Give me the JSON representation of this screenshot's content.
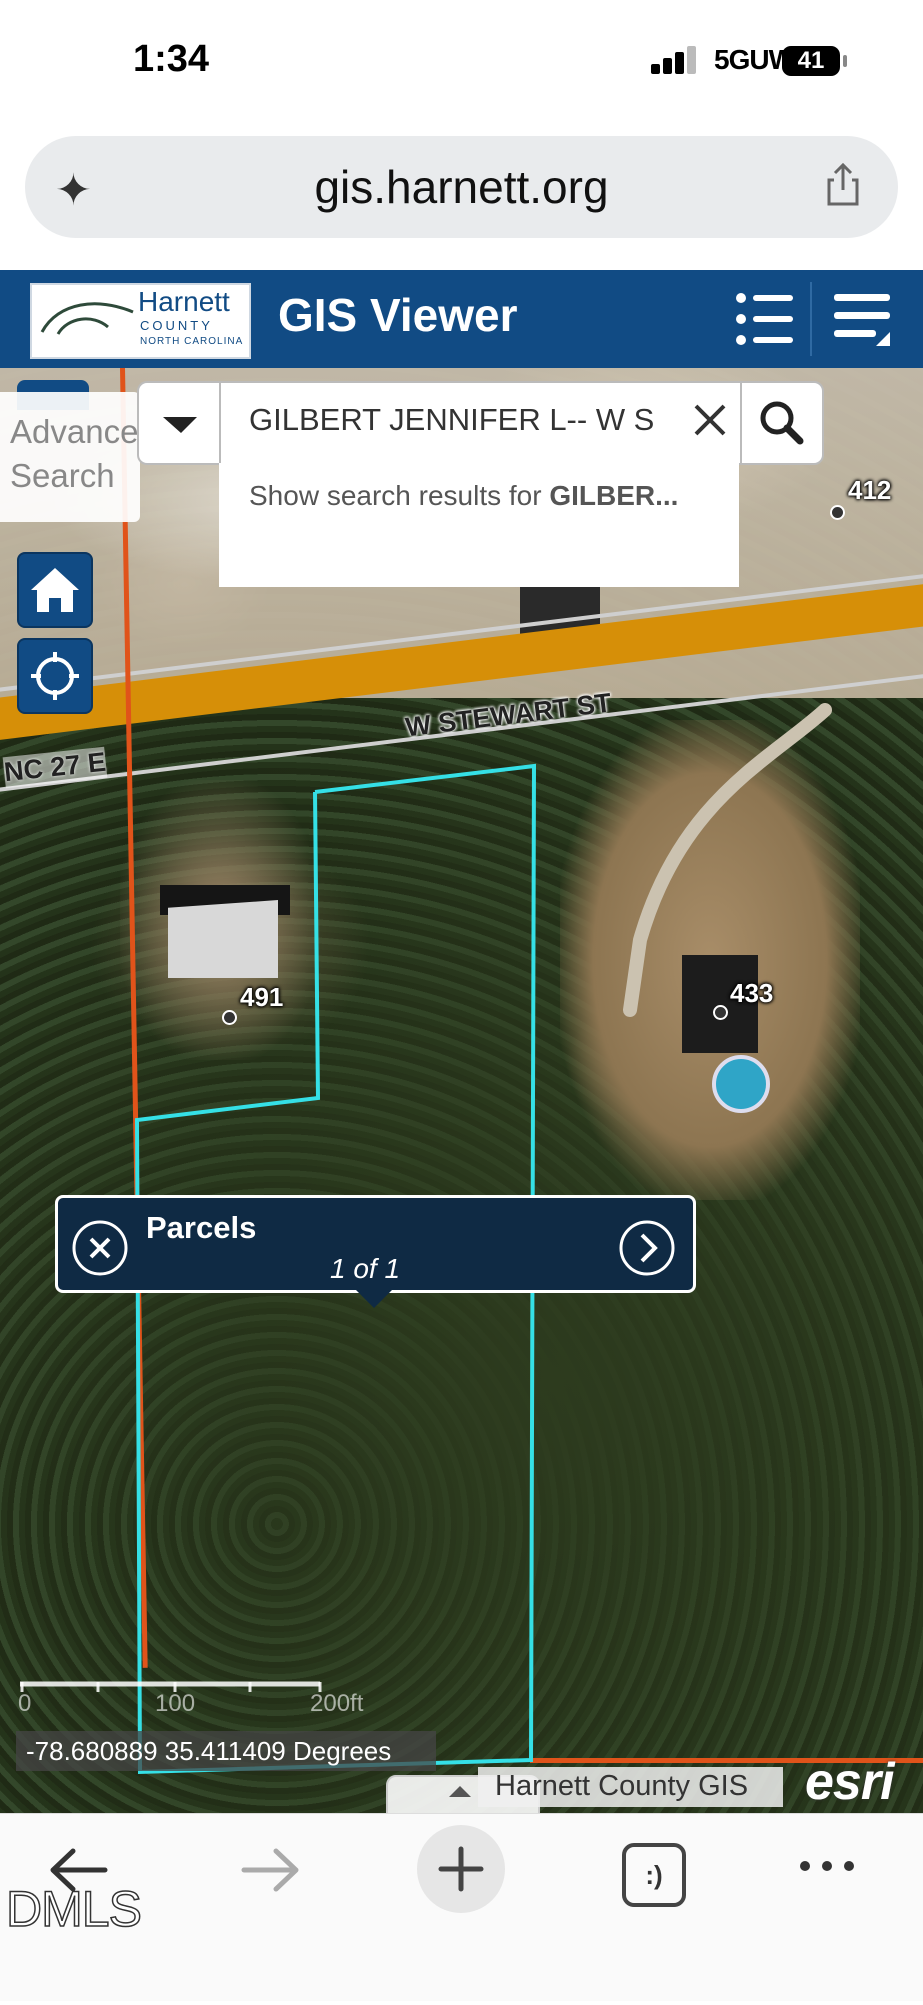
{
  "status_bar": {
    "time": "1:34",
    "network": "5GUW",
    "battery": "41"
  },
  "browser": {
    "url": "gis.harnett.org"
  },
  "app_header": {
    "logo_name": "Harnett",
    "logo_county": "COUNTY",
    "logo_state": "NORTH CAROLINA",
    "title": "GIS Viewer"
  },
  "search": {
    "advanced_label": "Advanced Search",
    "query": "GILBERT JENNIFER L-- W S",
    "suggestion_prefix": "Show search results for ",
    "suggestion_bold": "GILBER..."
  },
  "map": {
    "road_label": "W STEWART ST",
    "highway_label": "NC 27 E",
    "addresses": [
      "491",
      "433",
      "412"
    ],
    "scale_labels": [
      "0",
      "100",
      "200ft"
    ],
    "coordinates": "-78.680889 35.411409 Degrees",
    "attribution": "Harnett County GIS",
    "esri": "esri"
  },
  "popup": {
    "title": "Parcels",
    "count": "1 of 1"
  },
  "toolbar": {
    "tabs_label": ":)"
  },
  "watermark": "DMLS",
  "colors": {
    "header_blue": "#114b84",
    "parcel_outline": "#35e0e6",
    "road": "#d68f08",
    "popup_bg": "#0f2a44"
  }
}
